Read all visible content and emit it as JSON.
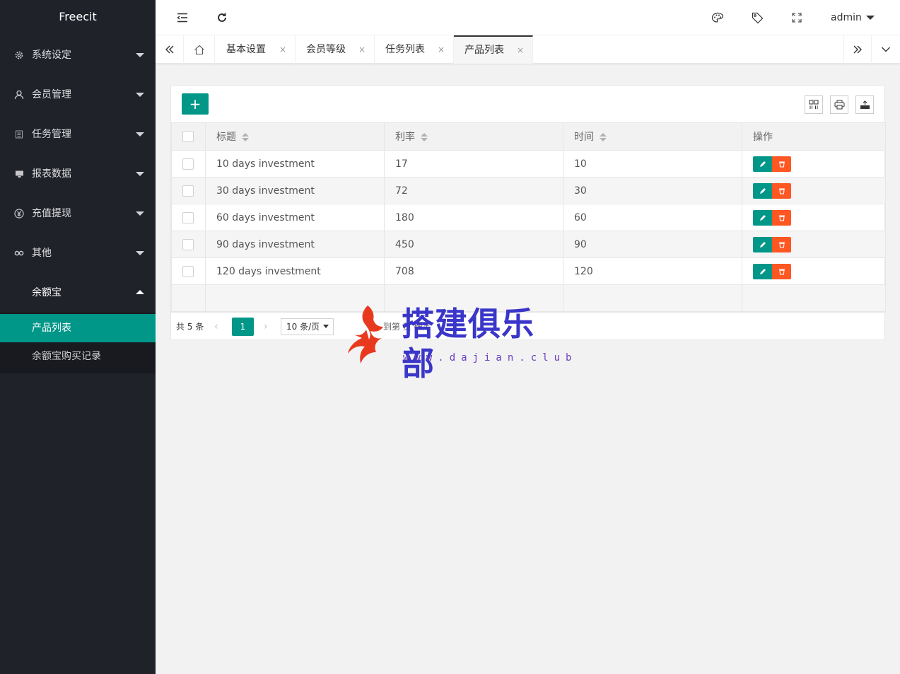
{
  "sidebar": {
    "logo": "Freecit",
    "items": [
      {
        "label": "系统设定",
        "icon": "gear-icon"
      },
      {
        "label": "会员管理",
        "icon": "user-icon"
      },
      {
        "label": "任务管理",
        "icon": "list-icon"
      },
      {
        "label": "报表数据",
        "icon": "report-icon"
      },
      {
        "label": "充值提现",
        "icon": "yuan-icon"
      },
      {
        "label": "其他",
        "icon": "link-icon"
      },
      {
        "label": "余额宝",
        "icon": ""
      }
    ],
    "sub_items": [
      {
        "label": "产品列表",
        "active": true
      },
      {
        "label": "余额宝购买记录",
        "active": false
      }
    ]
  },
  "header": {
    "user": "admin",
    "icons": [
      "menu-fold-icon",
      "refresh-icon",
      "palette-icon",
      "tag-icon",
      "fullscreen-icon"
    ]
  },
  "tabs": {
    "items": [
      {
        "label": "基本设置",
        "close": "×"
      },
      {
        "label": "会员等级",
        "close": "×"
      },
      {
        "label": "任务列表",
        "close": "×"
      },
      {
        "label": "产品列表",
        "close": "×",
        "active": true
      }
    ]
  },
  "table": {
    "add_label": "+",
    "columns": [
      "标题",
      "利率",
      "时间",
      "操作"
    ],
    "rows": [
      {
        "title": "10 days investment",
        "rate": "17",
        "time": "10"
      },
      {
        "title": "30 days investment",
        "rate": "72",
        "time": "30"
      },
      {
        "title": "60 days investment",
        "rate": "180",
        "time": "60"
      },
      {
        "title": "90 days investment",
        "rate": "450",
        "time": "90"
      },
      {
        "title": "120 days investment",
        "rate": "708",
        "time": "120"
      }
    ]
  },
  "pager": {
    "count": "共 5 条",
    "current": "1",
    "page_size": "10 条/页",
    "prev": "‹",
    "next": "›",
    "skip": "到第    页    确定"
  },
  "watermark": {
    "text": "搭建俱乐部",
    "url": "www.dajian.club"
  },
  "colors": {
    "accent": "#009688",
    "danger": "#ff5722",
    "sidebar": "#20222a"
  }
}
